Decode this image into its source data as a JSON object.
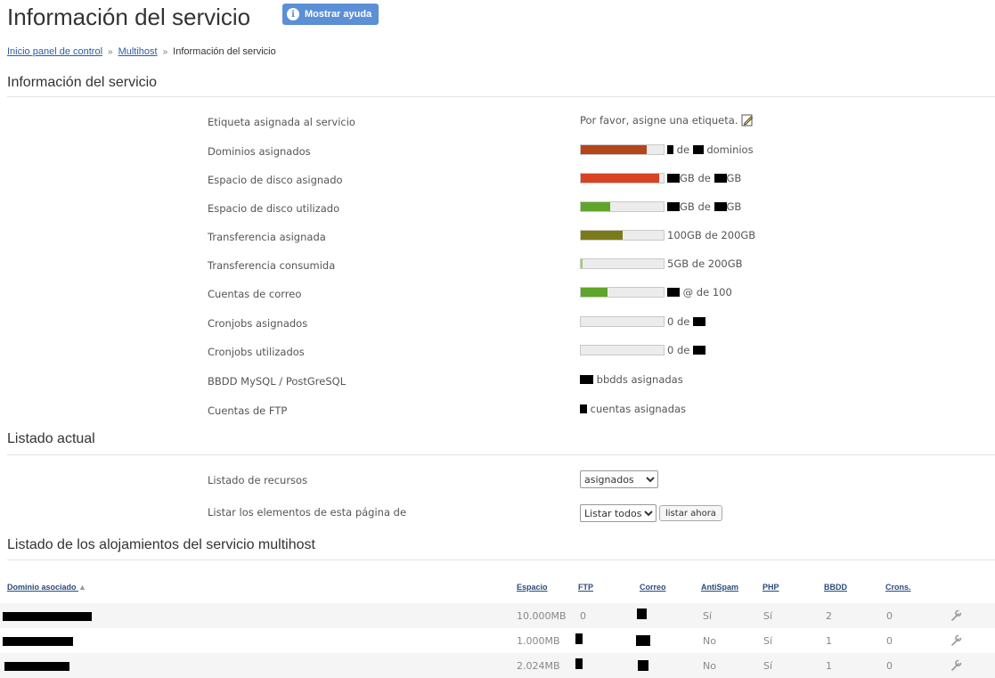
{
  "header": {
    "title": "Información del servicio",
    "help_label": "Mostrar ayuda",
    "help_icon": "info-icon"
  },
  "breadcrumb": {
    "items": [
      "Inicio panel de control",
      "Multihost"
    ],
    "current": "Información del servicio",
    "separator": "»"
  },
  "sections": {
    "info": "Información del servicio",
    "listing": "Listado actual",
    "hosts": "Listado de los alojamientos del servicio multihost"
  },
  "info_rows": [
    {
      "label": "Etiqueta asignada al servicio",
      "text": "Por favor, asigne una etiqueta.",
      "icon": "edit-icon"
    },
    {
      "label": "Dominios asignados",
      "fill": 0.8,
      "color": "#b5451b",
      "text": "de",
      "text2": "dominios"
    },
    {
      "label": "Espacio de disco asignado",
      "fill": 0.95,
      "color": "#d84323",
      "text": "GB de",
      "text2": "GB"
    },
    {
      "label": "Espacio de disco utilizado",
      "fill": 0.35,
      "color": "#5fa52a",
      "text": "GB de",
      "text2": "GB"
    },
    {
      "label": "Transferencia asignada",
      "fill": 0.5,
      "color": "#7a7a1a",
      "text": "100GB de 200GB"
    },
    {
      "label": "Transferencia consumida",
      "fill": 0.025,
      "color": "#8ad860",
      "text": "5GB de 200GB"
    },
    {
      "label": "Cuentas de correo",
      "fill": 0.32,
      "color": "#5fa52a",
      "text": "@ de 100"
    },
    {
      "label": "Cronjobs asignados",
      "fill": 0,
      "color": "#5fa52a",
      "text": "0 de"
    },
    {
      "label": "Cronjobs utilizados",
      "fill": 0,
      "color": "#5fa52a",
      "text": "0 de"
    },
    {
      "label": "BBDD MySQL / PostGreSQL",
      "text": "bbdds asignadas"
    },
    {
      "label": "Cuentas de FTP",
      "text": "cuentas asignadas"
    }
  ],
  "listing": {
    "resources_label": "Listado de recursos",
    "resources_value": "asignados",
    "elements_label": "Listar los elementos de esta página de",
    "elements_value": "Listar todos",
    "submit_label": "listar ahora"
  },
  "table": {
    "headers": {
      "domain": "Dominio asociado",
      "space": "Espacio",
      "ftp": "FTP",
      "mail": "Correo",
      "antispam": "AntiSpam",
      "php": "PHP",
      "bbdd": "BBDD",
      "crons": "Crons."
    },
    "sort_indicator": "▲",
    "rows": [
      {
        "space": "10.000MB",
        "ftp": "0",
        "antispam": "Sí",
        "php": "Sí",
        "bbdd": "2",
        "crons": "0"
      },
      {
        "space": "1.000MB",
        "ftp": "",
        "antispam": "No",
        "php": "Sí",
        "bbdd": "1",
        "crons": "0"
      },
      {
        "space": "2.024MB",
        "ftp": "",
        "antispam": "No",
        "php": "Sí",
        "bbdd": "1",
        "crons": "0"
      }
    ]
  }
}
